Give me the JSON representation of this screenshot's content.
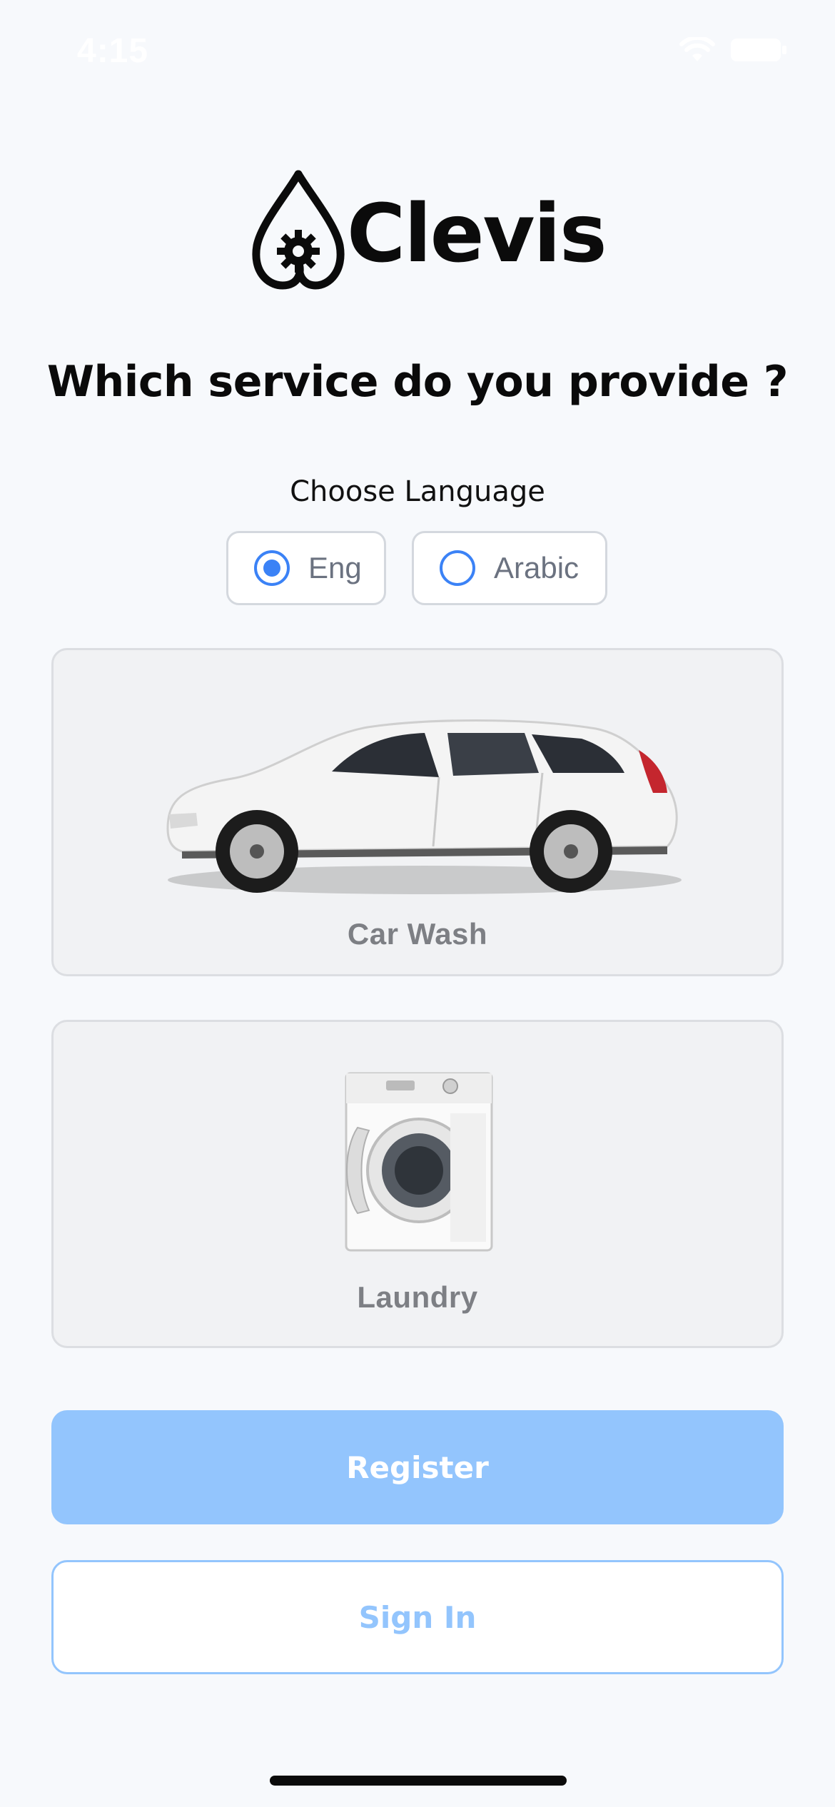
{
  "status_bar": {
    "time": "4:15",
    "icons": [
      "wifi-icon",
      "battery-icon"
    ]
  },
  "brand": {
    "name": "Clevis",
    "logo_icon": "droplet-gear-icon"
  },
  "heading": "Which service do you provide ?",
  "language": {
    "label": "Choose Language",
    "options": [
      {
        "label": "Eng",
        "selected": true
      },
      {
        "label": "Arabic",
        "selected": false
      }
    ],
    "accent_color": "#3b82f6"
  },
  "services": [
    {
      "label": "Car Wash",
      "icon": "car-image"
    },
    {
      "label": "Laundry",
      "icon": "washing-machine-image"
    }
  ],
  "actions": {
    "register_label": "Register",
    "signin_label": "Sign In",
    "primary_color": "#93c5fd"
  }
}
